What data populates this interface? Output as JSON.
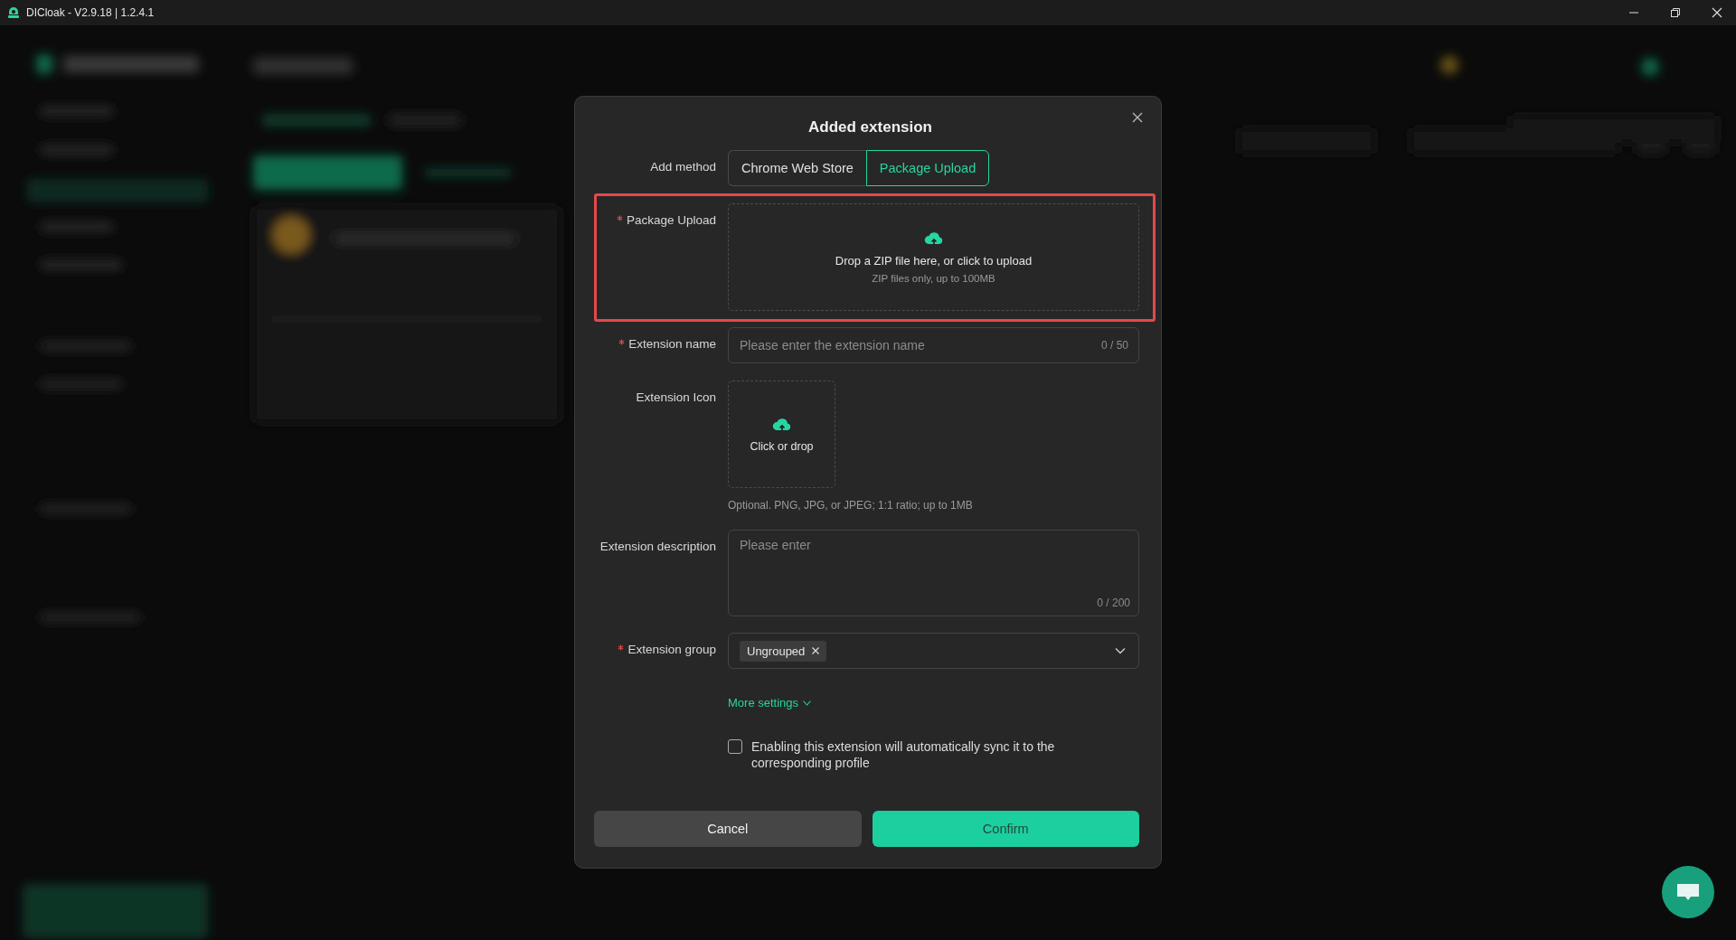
{
  "window": {
    "title": "DICloak - V2.9.18 | 1.2.4.1"
  },
  "dialog": {
    "title": "Added extension",
    "add_method": {
      "label": "Add method",
      "options": [
        {
          "label": "Chrome Web Store",
          "selected": false
        },
        {
          "label": "Package Upload",
          "selected": true
        }
      ]
    },
    "package_upload": {
      "label": "Package Upload",
      "required": true,
      "highlighted": true,
      "prompt": "Drop a ZIP file here, or click to upload",
      "hint": "ZIP files only, up to 100MB"
    },
    "extension_name": {
      "label": "Extension name",
      "required": true,
      "placeholder": "Please enter the extension name",
      "counter": "0 / 50"
    },
    "extension_icon": {
      "label": "Extension Icon",
      "required": false,
      "prompt": "Click or drop",
      "hint": "Optional. PNG, JPG, or JPEG; 1:1 ratio; up to 1MB"
    },
    "extension_description": {
      "label": "Extension description",
      "required": false,
      "placeholder": "Please enter",
      "counter": "0 / 200"
    },
    "extension_group": {
      "label": "Extension group",
      "required": true,
      "tags": [
        "Ungrouped"
      ]
    },
    "more_settings": "More settings",
    "sync": {
      "label": "Enabling this extension will automatically sync it to the corresponding profile",
      "checked": false
    },
    "buttons": [
      {
        "kind": "cancel",
        "label": "Cancel"
      },
      {
        "kind": "confirm",
        "label": "Confirm"
      }
    ]
  }
}
